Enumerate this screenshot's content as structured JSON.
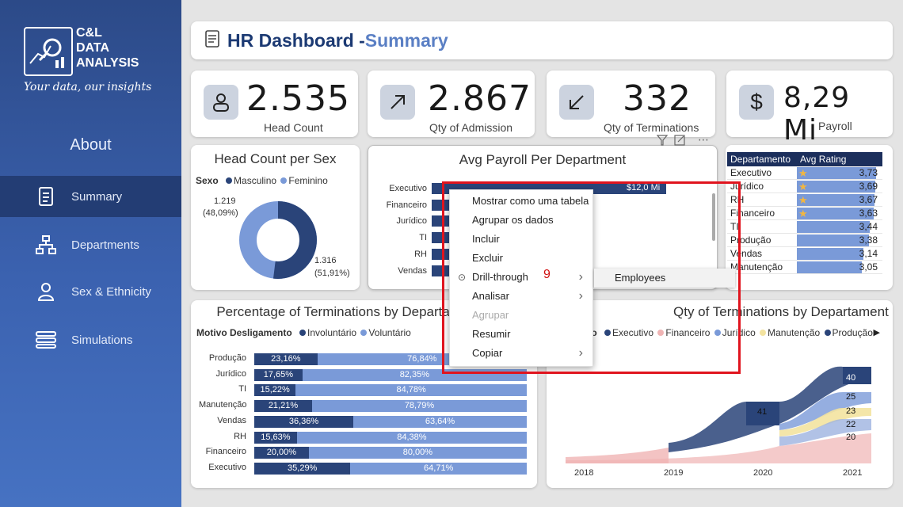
{
  "brand": {
    "logo_lines": [
      "C&L",
      "DATA",
      "ANALYSIS"
    ],
    "tagline": "Your data, our insights"
  },
  "sidebar": {
    "about": "About",
    "items": [
      {
        "label": "Summary",
        "icon": "document-icon"
      },
      {
        "label": "Departments",
        "icon": "org-chart-icon"
      },
      {
        "label": "Sex & Ethnicity",
        "icon": "person-icon"
      },
      {
        "label": "Simulations",
        "icon": "sliders-icon"
      }
    ]
  },
  "header": {
    "title_main": "HR Dashboard - ",
    "title_accent": "Summary"
  },
  "kpis": [
    {
      "value": "2.535",
      "label": "Head Count",
      "icon": "person-icon"
    },
    {
      "value": "2.867",
      "label": "Qty of Admission",
      "icon": "arrow-up-right-icon"
    },
    {
      "value": "332",
      "label": "Qty of Terminations",
      "icon": "arrow-down-left-icon"
    },
    {
      "value": "8,29 Mi",
      "label": "Payroll",
      "icon": "dollar-icon"
    }
  ],
  "sex_chart": {
    "title": "Head Count per Sex",
    "legend_title": "Sexo",
    "legend": [
      "Masculino",
      "Feminino"
    ],
    "label_f": "1.219",
    "label_f_pct": "(48,09%)",
    "label_m": "1.316",
    "label_m_pct": "(51,91%)"
  },
  "payroll_chart": {
    "title": "Avg Payroll Per Department",
    "categories": [
      "Executivo",
      "Financeiro",
      "Jurídico",
      "TI",
      "RH",
      "Vendas"
    ],
    "top_value_label": "$12,0 Mi"
  },
  "rating_table": {
    "headers": [
      "Departamento",
      "Avg Rating"
    ],
    "rows": [
      {
        "dept": "Executivo",
        "rating": "3,73",
        "star": true
      },
      {
        "dept": "Jurídico",
        "rating": "3,69",
        "star": true
      },
      {
        "dept": "RH",
        "rating": "3,67",
        "star": true
      },
      {
        "dept": "Financeiro",
        "rating": "3,63",
        "star": true
      },
      {
        "dept": "TI",
        "rating": "3,44",
        "star": false
      },
      {
        "dept": "Produção",
        "rating": "3,38",
        "star": false
      },
      {
        "dept": "Vendas",
        "rating": "3,14",
        "star": false
      },
      {
        "dept": "Manutenção",
        "rating": "3,05",
        "star": false
      }
    ]
  },
  "term_pct_chart": {
    "title": "Percentage of Terminations by Departament",
    "legend_title": "Motivo Desligamento",
    "legend": [
      "Involuntário",
      "Voluntário"
    ],
    "rows": [
      {
        "dept": "Produção",
        "inv": "23,16%",
        "vol": "76,84%"
      },
      {
        "dept": "Jurídico",
        "inv": "17,65%",
        "vol": "82,35%"
      },
      {
        "dept": "TI",
        "inv": "15,22%",
        "vol": "84,78%"
      },
      {
        "dept": "Manutenção",
        "inv": "21,21%",
        "vol": "78,79%"
      },
      {
        "dept": "Vendas",
        "inv": "36,36%",
        "vol": "63,64%"
      },
      {
        "dept": "RH",
        "inv": "15,63%",
        "vol": "84,38%"
      },
      {
        "dept": "Financeiro",
        "inv": "20,00%",
        "vol": "80,00%"
      },
      {
        "dept": "Executivo",
        "inv": "35,29%",
        "vol": "64,71%"
      }
    ]
  },
  "term_qty_chart": {
    "title": "Qty of Terminations by Departament",
    "legend_title_fragment": "nto",
    "legend": [
      "Executivo",
      "Financeiro",
      "Jurídico",
      "Manutenção",
      "Produção"
    ],
    "years": [
      "2018",
      "2019",
      "2020",
      "2021"
    ],
    "labels": [
      "41",
      "40",
      "25",
      "23",
      "22",
      "20"
    ]
  },
  "context_menu": {
    "items": [
      {
        "label": "Mostrar como uma tabela",
        "disabled": false,
        "submenu": false
      },
      {
        "label": "Agrupar os dados",
        "disabled": false,
        "submenu": false
      },
      {
        "label": "Incluir",
        "disabled": false,
        "submenu": false
      },
      {
        "label": "Excluir",
        "disabled": false,
        "submenu": false
      },
      {
        "label": "Drill-through",
        "disabled": false,
        "submenu": true
      },
      {
        "label": "Analisar",
        "disabled": false,
        "submenu": true
      },
      {
        "label": "Agrupar",
        "disabled": true,
        "submenu": false
      },
      {
        "label": "Resumir",
        "disabled": false,
        "submenu": false
      },
      {
        "label": "Copiar",
        "disabled": false,
        "submenu": true
      }
    ],
    "submenu_item": "Employees",
    "annotation": "9"
  },
  "colors": {
    "dark_blue": "#2a4479",
    "light_blue": "#7a9ad8",
    "highlight": "#e0141e",
    "pink": "#f0b4b4",
    "yellow": "#f3e3a0"
  }
}
